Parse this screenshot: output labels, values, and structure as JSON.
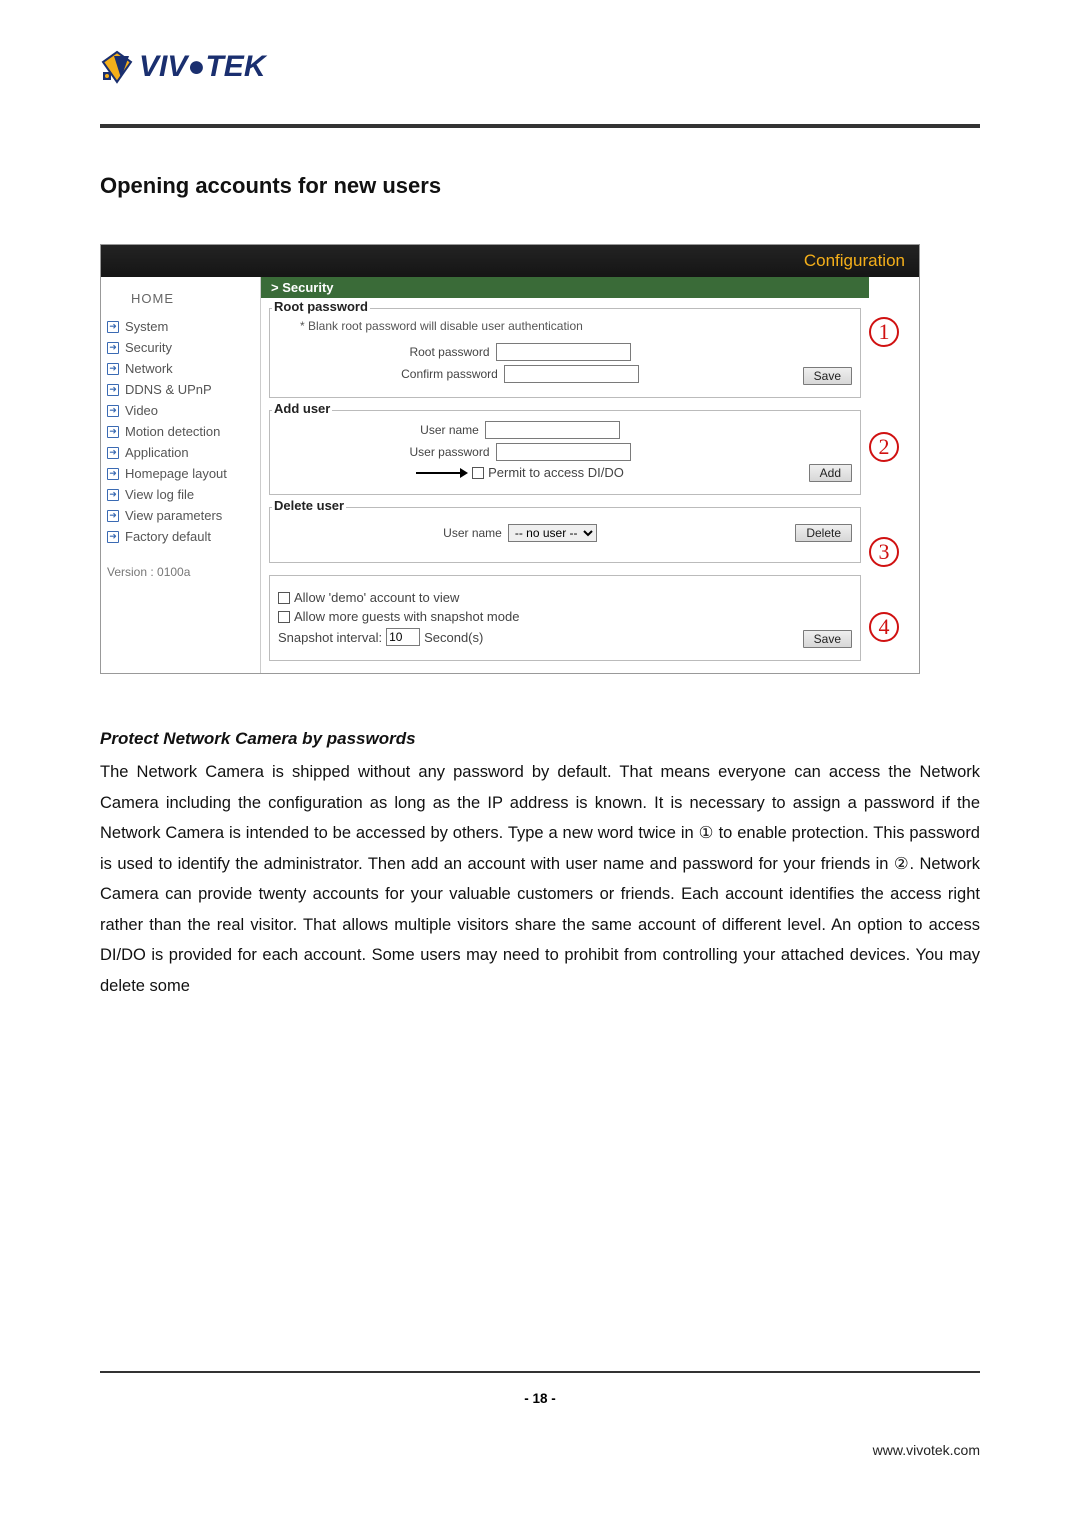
{
  "brand": {
    "name": "VIVOTEK"
  },
  "section_title": "Opening accounts for new users",
  "config": {
    "header": "Configuration",
    "breadcrumb": "> Security",
    "sidebar": {
      "home": "HOME",
      "items": [
        {
          "label": "System"
        },
        {
          "label": "Security"
        },
        {
          "label": "Network"
        },
        {
          "label": "DDNS & UPnP"
        },
        {
          "label": "Video"
        },
        {
          "label": "Motion detection"
        },
        {
          "label": "Application"
        },
        {
          "label": "Homepage layout"
        },
        {
          "label": "View log file"
        },
        {
          "label": "View parameters"
        },
        {
          "label": "Factory default"
        }
      ],
      "version": "Version : 0100a"
    },
    "rootpw": {
      "legend": "Root password",
      "hint": "* Blank root password will disable user authentication",
      "label_root": "Root password",
      "label_confirm": "Confirm password",
      "save_btn": "Save"
    },
    "adduser": {
      "legend": "Add user",
      "label_username": "User name",
      "label_userpw": "User password",
      "permit_label": "Permit to access DI/DO",
      "add_btn": "Add"
    },
    "deleteuser": {
      "legend": "Delete user",
      "label_username": "User name",
      "select_value": "-- no user --",
      "delete_btn": "Delete"
    },
    "guest": {
      "cb_demo": "Allow 'demo' account to view",
      "cb_more_guests": "Allow more guests with snapshot mode",
      "snapshot_label_prefix": "Snapshot interval:",
      "snapshot_value": "10",
      "snapshot_unit": "Second(s)",
      "save_btn": "Save"
    },
    "annotations": {
      "one": "1",
      "two": "2",
      "three": "3",
      "four": "4"
    }
  },
  "subsection_title": "Protect Network Camera by passwords",
  "body_text": "The Network Camera is shipped without any password by default. That means everyone can access the Network Camera including the configuration as long as the IP address is known. It is necessary to assign a password if the Network Camera is intended to be accessed by others. Type a new word twice in ① to enable protection. This password is used to identify the administrator. Then add an account with user name and password for your friends in ②. Network Camera can provide twenty accounts for your valuable customers or friends. Each account identifies the access right rather than the real visitor. That allows multiple visitors share the same account of different level.  An option to access DI/DO is provided for each account. Some users may need to prohibit from controlling your attached devices. You may delete some",
  "page_number": "- 18 -",
  "footer_url": "www.vivotek.com"
}
